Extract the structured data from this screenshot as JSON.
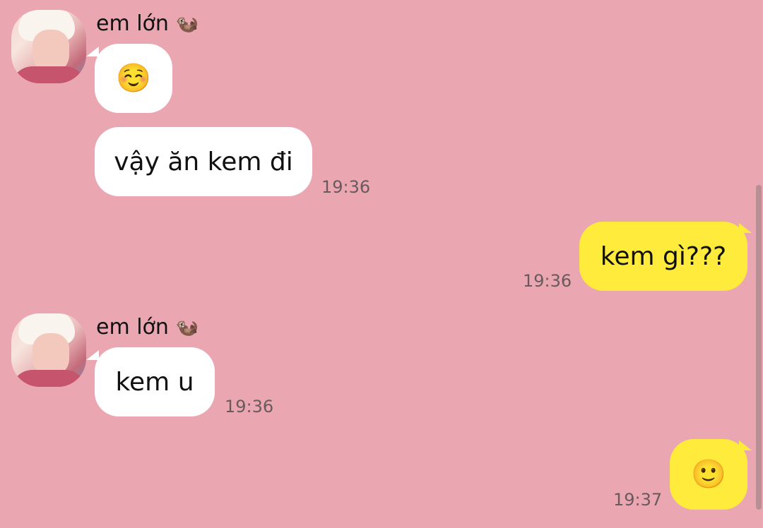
{
  "messages": [
    {
      "sender": "em lớn",
      "sender_emoji": "🦦",
      "text": "☺️",
      "time": ""
    },
    {
      "sender": "em lớn",
      "text": "vậy ăn kem đi",
      "time": "19:36"
    },
    {
      "sender": "me",
      "text": "kem gì???",
      "time": "19:36"
    },
    {
      "sender": "em lớn",
      "sender_emoji": "🦦",
      "text": "kem u",
      "time": "19:36"
    },
    {
      "sender": "me",
      "text": "🙂",
      "time": "19:37"
    }
  ],
  "colors": {
    "background": "#eba7b1",
    "incoming_bubble": "#ffffff",
    "outgoing_bubble": "#ffeb3b",
    "time_text": "#6a5a5d"
  }
}
